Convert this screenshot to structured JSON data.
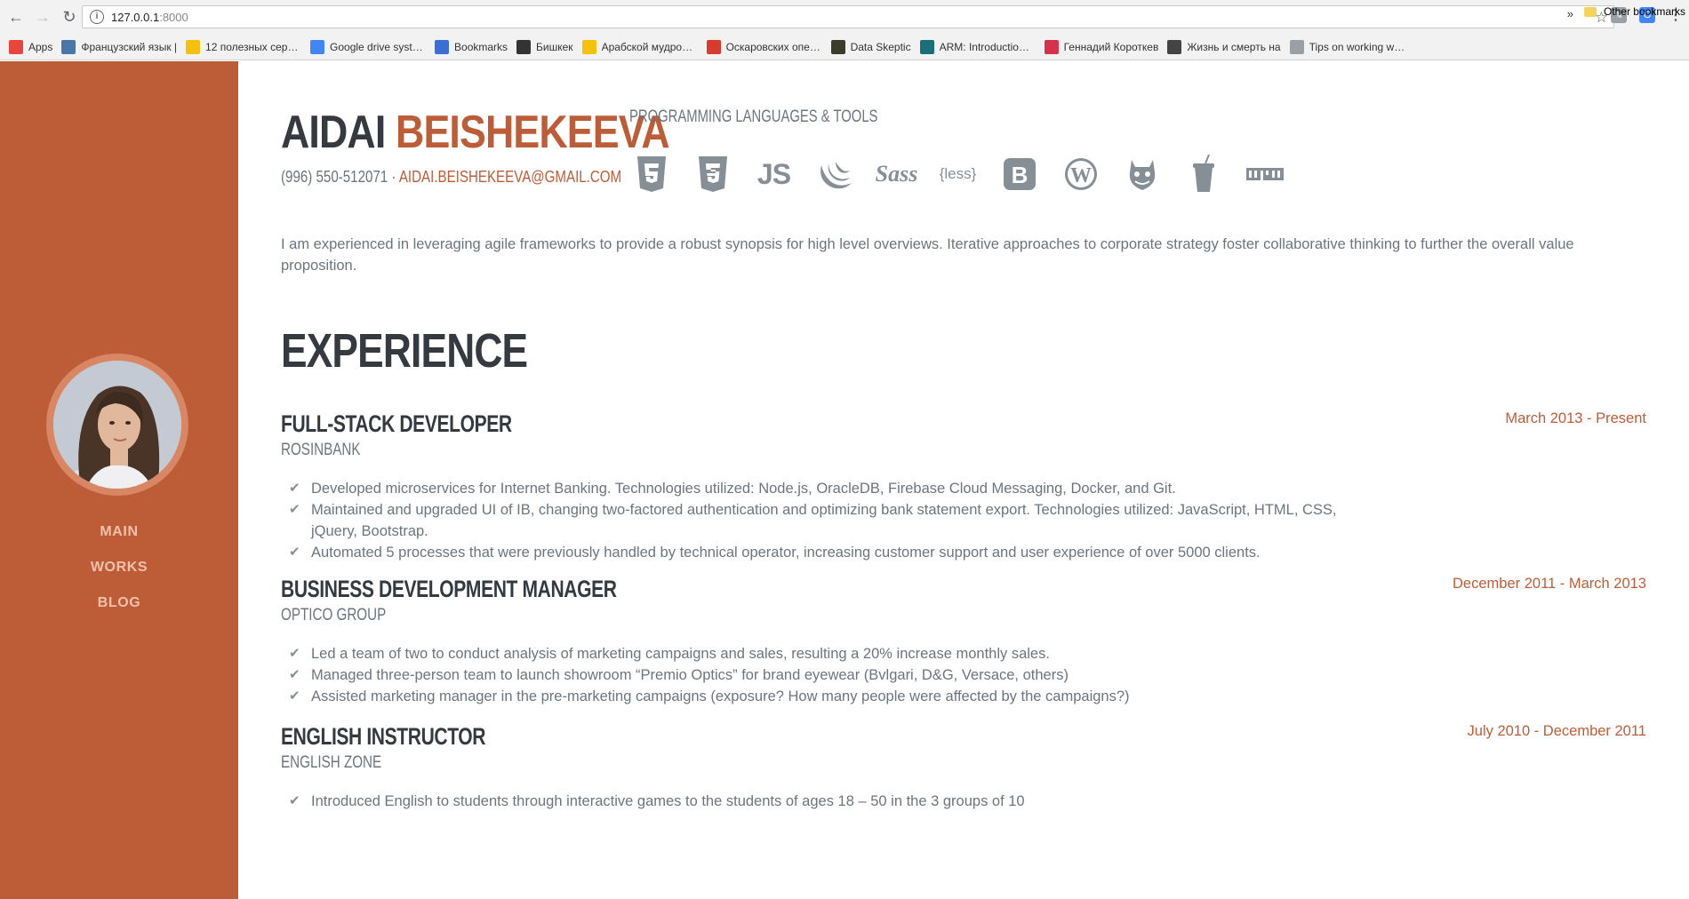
{
  "browser": {
    "url_host": "127.0.0.1",
    "url_port": ":8000",
    "bookmarks": [
      {
        "label": "Apps",
        "icon": "apps-grid-icon",
        "color": "#e8453c"
      },
      {
        "label": "Французский язык |",
        "icon": "vk-icon",
        "color": "#4a76a8"
      },
      {
        "label": "12 полезных сервис",
        "icon": "ad-icon",
        "color": "#f4c20d"
      },
      {
        "label": "Google drive system",
        "icon": "docs-icon",
        "color": "#4285f4"
      },
      {
        "label": "Bookmarks",
        "icon": "star-icon",
        "color": "#3b6fd6"
      },
      {
        "label": "Бишкек",
        "icon": "book-icon",
        "color": "#333333"
      },
      {
        "label": "Арабской мудрости",
        "icon": "ad-icon",
        "color": "#f4c20d"
      },
      {
        "label": "Оскаровских операт",
        "icon": "page-icon",
        "color": "#d83b2b"
      },
      {
        "label": "Data Skeptic",
        "icon": "ds-icon",
        "color": "#3c3c2c"
      },
      {
        "label": "ARM: Introduction to",
        "icon": "ds-circle-icon",
        "color": "#1b6f7a"
      },
      {
        "label": "Геннадий Короткев",
        "icon": "rk-icon",
        "color": "#d6324b"
      },
      {
        "label": "Жизнь и смерть на",
        "icon": "t-circle-icon",
        "color": "#444444"
      },
      {
        "label": "Tips on working with",
        "icon": "lines-icon",
        "color": "#9aa0a6"
      }
    ],
    "more_label": "»",
    "other_bookmarks": "Other bookmarks"
  },
  "sidebar": {
    "nav": [
      "Main",
      "Works",
      "Blog"
    ]
  },
  "profile": {
    "first_name": "Aidai",
    "last_name": "Beishekeeva",
    "phone": "(996) 550-512071 ·",
    "email": "aidai.beishekeeva@gmail.com",
    "tools_title": "Programming Languages & Tools",
    "tools": [
      "html5",
      "css3",
      "js",
      "jquery",
      "sass",
      "less",
      "bootstrap",
      "wordpress",
      "grunt",
      "gulp",
      "npm"
    ],
    "about": "I am experienced in leveraging agile frameworks to provide a robust synopsis for high level overviews. Iterative approaches to corporate strategy foster collaborative thinking to further the overall value proposition."
  },
  "experience": {
    "title": "Experience",
    "jobs": [
      {
        "title": "Full-Stack Developer",
        "company": "Rosinbank",
        "date": "March 2013 - Present",
        "items": [
          "Developed microservices for Internet Banking. Technologies utilized: Node.js, OracleDB, Firebase Cloud Messaging, Docker, and Git.",
          "Maintained and upgraded UI of IB, changing two-factored authentication and optimizing bank statement export. Technologies utilized: JavaScript, HTML, CSS, jQuery, Bootstrap.",
          "Automated 5 processes that were previously handled by technical operator, increasing customer support and user experience of over 5000 clients."
        ]
      },
      {
        "title": "Business Development Manager",
        "company": "Optico Group",
        "date": "December 2011 - March 2013",
        "items": [
          "Led a team of two to conduct analysis of marketing campaigns and sales, resulting a 20% increase monthly sales.",
          "Managed three-person team to launch showroom “Premio Optics” for brand eyewear (Bvlgari, D&G, Versace, others)",
          "Assisted marketing manager in the pre-marketing campaigns (exposure? How many people were affected by the campaigns?)"
        ]
      },
      {
        "title": "English Instructor",
        "company": "English Zone",
        "date": "July 2010 - December 2011",
        "items": [
          "Introduced English to students through interactive games to the students of ages 18 – 50 in the 3 groups of 10"
        ]
      }
    ]
  },
  "colors": {
    "accent": "#bd5d38",
    "heading": "#343a40",
    "text": "#6c757d"
  }
}
